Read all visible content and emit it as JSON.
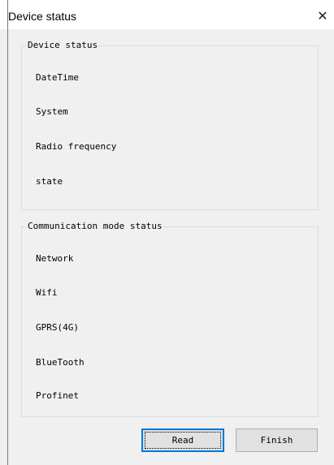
{
  "window": {
    "title": "Device status",
    "close_glyph": "✕"
  },
  "device_status": {
    "legend": "Device status",
    "rows": [
      "DateTime",
      "System",
      "Radio frequency",
      "state"
    ]
  },
  "communication_status": {
    "legend": "Communication mode status",
    "rows": [
      "Network",
      "Wifi",
      "GPRS(4G)",
      "BlueTooth",
      "Profinet"
    ]
  },
  "buttons": {
    "read_label": "Read",
    "finish_label": "Finish"
  }
}
